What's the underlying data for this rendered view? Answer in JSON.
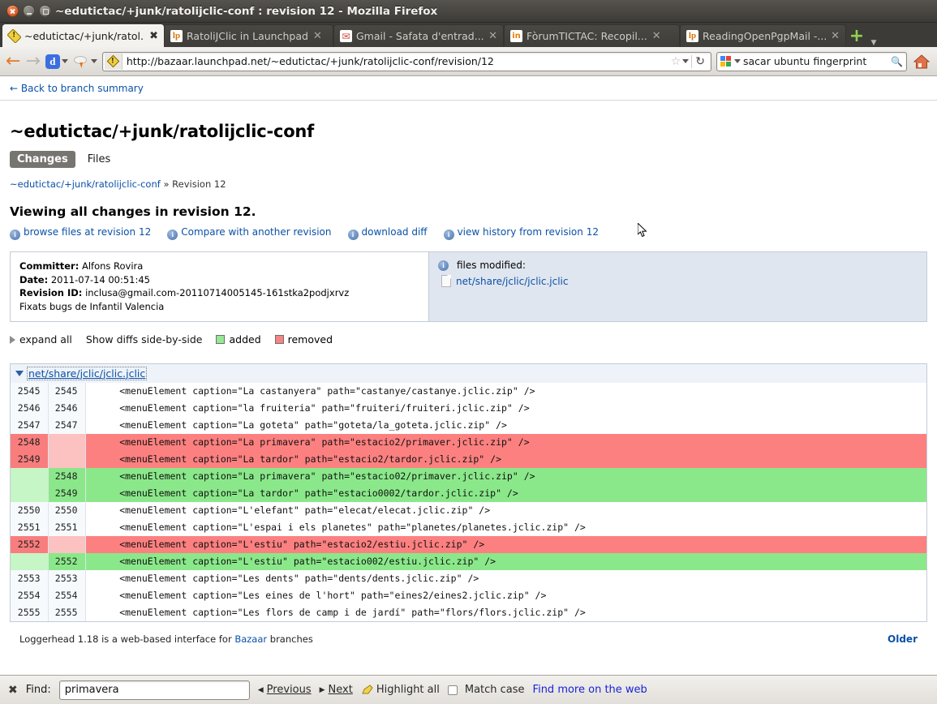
{
  "window": {
    "title": "~edutictac/+junk/ratolijclic-conf : revision 12 - Mozilla Firefox",
    "buttons": {
      "close": "close-window",
      "minimize": "minimize-window",
      "maximize": "maximize-window"
    }
  },
  "tabs": [
    {
      "label": "~edutictac/+junk/ratol...",
      "favicon": "warning-diamond-icon",
      "active": true
    },
    {
      "label": "RatoliJClic in Launchpad",
      "favicon": "launchpad-icon",
      "active": false
    },
    {
      "label": "Gmail - Safata d'entrad...",
      "favicon": "gmail-icon",
      "active": false
    },
    {
      "label": "FòrumTICTAC: Recopil...",
      "favicon": "forum-icon",
      "active": false
    },
    {
      "label": "ReadingOpenPgpMail -...",
      "favicon": "launchpad-icon",
      "active": false
    }
  ],
  "newtab_label": "+",
  "navbar": {
    "back": "←",
    "forward": "→",
    "downloads_label": "d",
    "url": "http://bazaar.launchpad.net/~edutictac/+junk/ratolijclic-conf/revision/12",
    "star": "☆",
    "reload": "↻",
    "search_value": "sacar ubuntu fingerprint",
    "search_engine": "google-icon",
    "home": "home-icon"
  },
  "page": {
    "back_link": "← Back to branch summary",
    "title": "~edutictac/+junk/ratolijclic-conf",
    "tabs": [
      {
        "label": "Changes",
        "selected": true
      },
      {
        "label": "Files",
        "selected": false
      }
    ],
    "breadcrumb_link": "~edutictac/+junk/ratolijclic-conf",
    "breadcrumb_sep": " » ",
    "breadcrumb_current": "Revision 12",
    "viewing_heading": "Viewing all changes in revision 12.",
    "actions": [
      "browse files at revision 12",
      "Compare with another revision",
      "download diff",
      "view history from revision 12"
    ],
    "commit": {
      "committer_label": "Committer:",
      "committer_value": "Alfons Rovira",
      "date_label": "Date:",
      "date_value": "2011-07-14 00:51:45",
      "revid_label": "Revision ID:",
      "revid_value": "inclusa@gmail.com-20110714005145-161stka2podjxrvz",
      "message": "Fixats bugs de Infantil Valencia"
    },
    "files_modified": {
      "heading": "files modified:",
      "files": [
        "net/share/jclic/jclic.jclic"
      ]
    },
    "legend": {
      "expand_all": "expand all",
      "side_by_side": "Show diffs side-by-side",
      "added": "added",
      "removed": "removed",
      "added_color": "#8ae88a",
      "removed_color": "#fd8080"
    },
    "diff_file_name": "net/share/jclic/jclic.jclic",
    "diff_rows": [
      {
        "type": "ctx",
        "old": "2545",
        "new": "2545",
        "code": "    <menuElement caption=\"La castanyera\" path=\"castanye/castanye.jclic.zip\" />"
      },
      {
        "type": "ctx",
        "old": "2546",
        "new": "2546",
        "code": "    <menuElement caption=\"la fruiteria\" path=\"fruiteri/fruiteri.jclic.zip\" />"
      },
      {
        "type": "ctx",
        "old": "2547",
        "new": "2547",
        "code": "    <menuElement caption=\"La goteta\" path=\"goteta/la_goteta.jclic.zip\" />"
      },
      {
        "type": "rem",
        "old": "2548",
        "new": "",
        "code": "    <menuElement caption=\"La primavera\" path=\"estacio2/primaver.jclic.zip\" />"
      },
      {
        "type": "rem",
        "old": "2549",
        "new": "",
        "code": "    <menuElement caption=\"La tardor\" path=\"estacio2/tardor.jclic.zip\" />"
      },
      {
        "type": "add",
        "old": "",
        "new": "2548",
        "code": "    <menuElement caption=\"La primavera\" path=\"estacio02/primaver.jclic.zip\" />"
      },
      {
        "type": "add",
        "old": "",
        "new": "2549",
        "code": "    <menuElement caption=\"La tardor\" path=\"estacio0002/tardor.jclic.zip\" />"
      },
      {
        "type": "ctx",
        "old": "2550",
        "new": "2550",
        "code": "    <menuElement caption=\"L'elefant\" path=\"elecat/elecat.jclic.zip\" />"
      },
      {
        "type": "ctx",
        "old": "2551",
        "new": "2551",
        "code": "    <menuElement caption=\"L'espai i els planetes\" path=\"planetes/planetes.jclic.zip\" />"
      },
      {
        "type": "rem",
        "old": "2552",
        "new": "",
        "code": "    <menuElement caption=\"L'estiu\" path=\"estacio2/estiu.jclic.zip\" />"
      },
      {
        "type": "add",
        "old": "",
        "new": "2552",
        "code": "    <menuElement caption=\"L'estiu\" path=\"estacio002/estiu.jclic.zip\" />"
      },
      {
        "type": "ctx",
        "old": "2553",
        "new": "2553",
        "code": "    <menuElement caption=\"Les dents\" path=\"dents/dents.jclic.zip\" />"
      },
      {
        "type": "ctx",
        "old": "2554",
        "new": "2554",
        "code": "    <menuElement caption=\"Les eines de l'hort\" path=\"eines2/eines2.jclic.zip\" />"
      },
      {
        "type": "ctx",
        "old": "2555",
        "new": "2555",
        "code": "    <menuElement caption=\"Les flors de camp i de jardí\" path=\"flors/flors.jclic.zip\" />"
      }
    ],
    "footer_text_1": "Loggerhead 1.18 is a web-based interface for ",
    "footer_link": "Bazaar",
    "footer_text_2": " branches",
    "older_label": "Older"
  },
  "findbar": {
    "close": "✖",
    "label": "Find:",
    "value": "primavera",
    "placeholder": "",
    "previous": "Previous",
    "next": "Next",
    "highlight_all": "Highlight all",
    "match_case": "Match case",
    "find_more": "Find more on the web"
  }
}
